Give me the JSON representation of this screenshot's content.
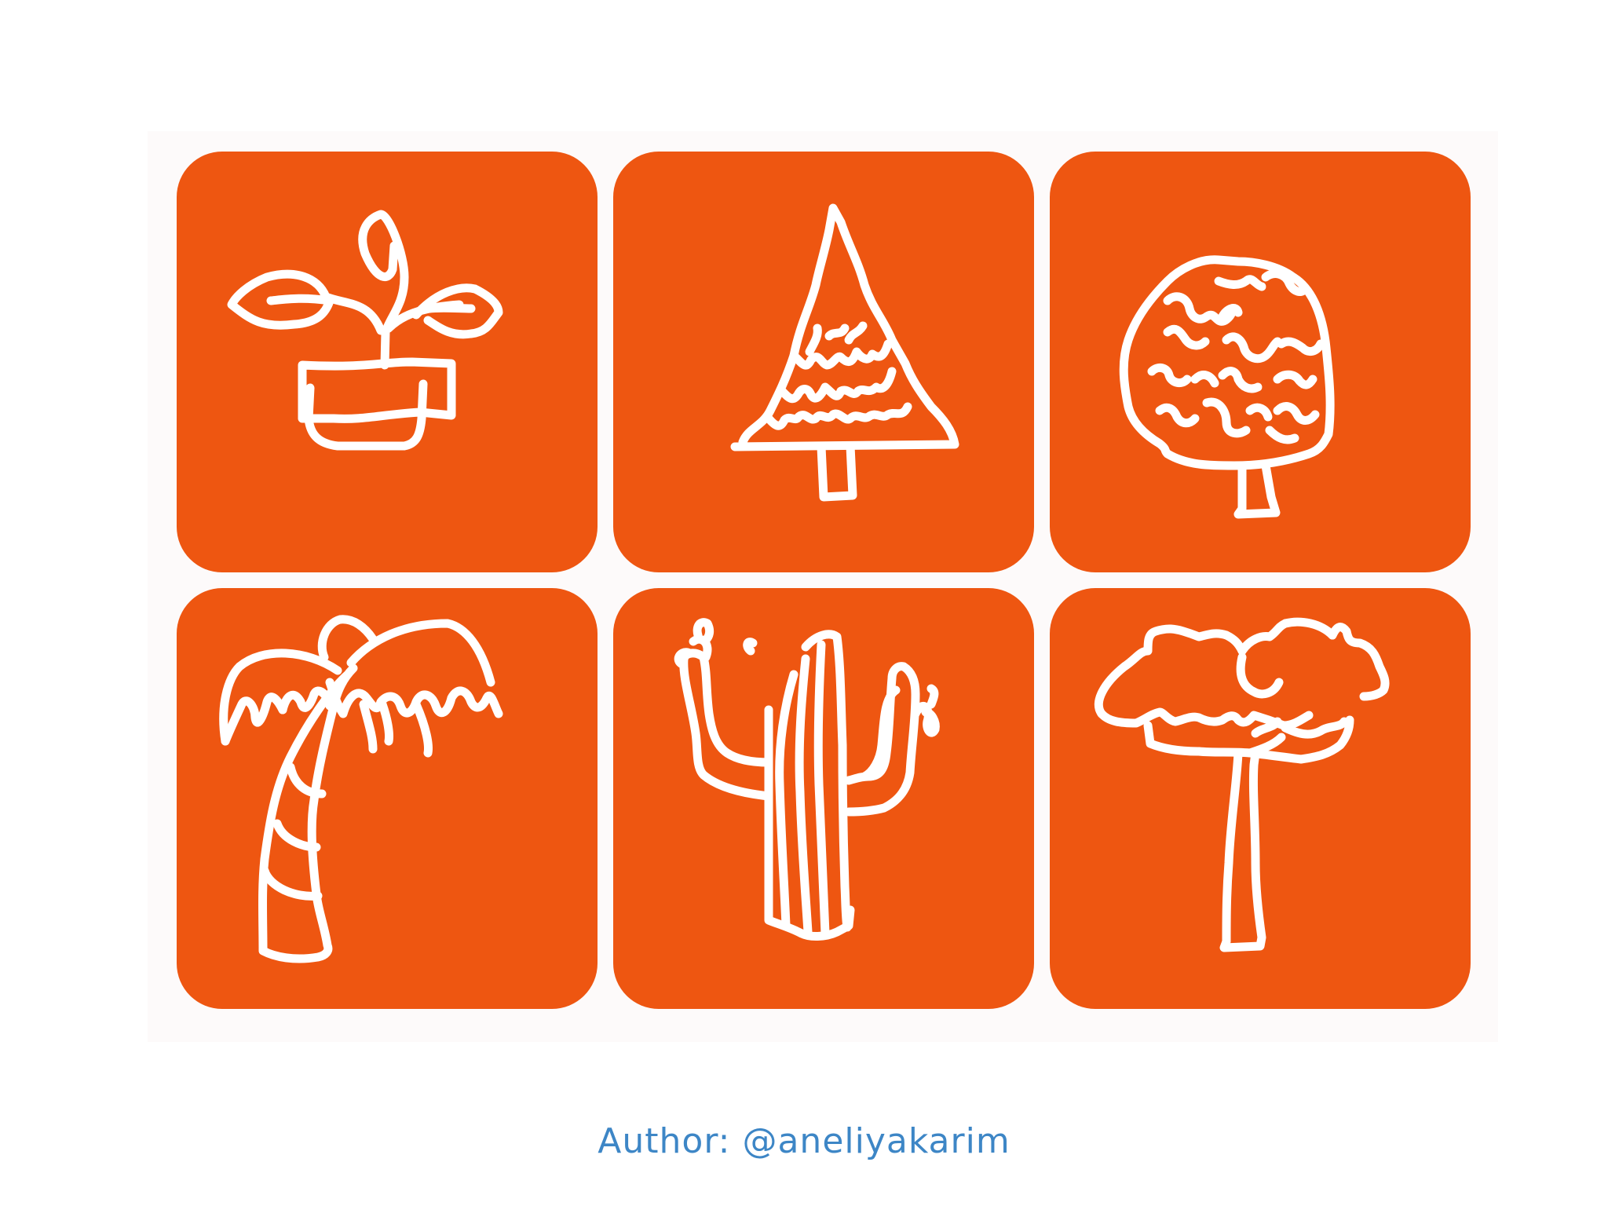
{
  "colors": {
    "tile": "#ee5611",
    "stroke": "#ffffff",
    "credit": "#3d86c6",
    "background": "#ffffff"
  },
  "tiles": [
    {
      "icon": "potted-plant-icon"
    },
    {
      "icon": "pine-tree-icon"
    },
    {
      "icon": "round-tree-icon"
    },
    {
      "icon": "palm-tree-icon"
    },
    {
      "icon": "cactus-icon"
    },
    {
      "icon": "acacia-tree-icon"
    }
  ],
  "credit": {
    "text": "Author: @aneliyakarim"
  }
}
